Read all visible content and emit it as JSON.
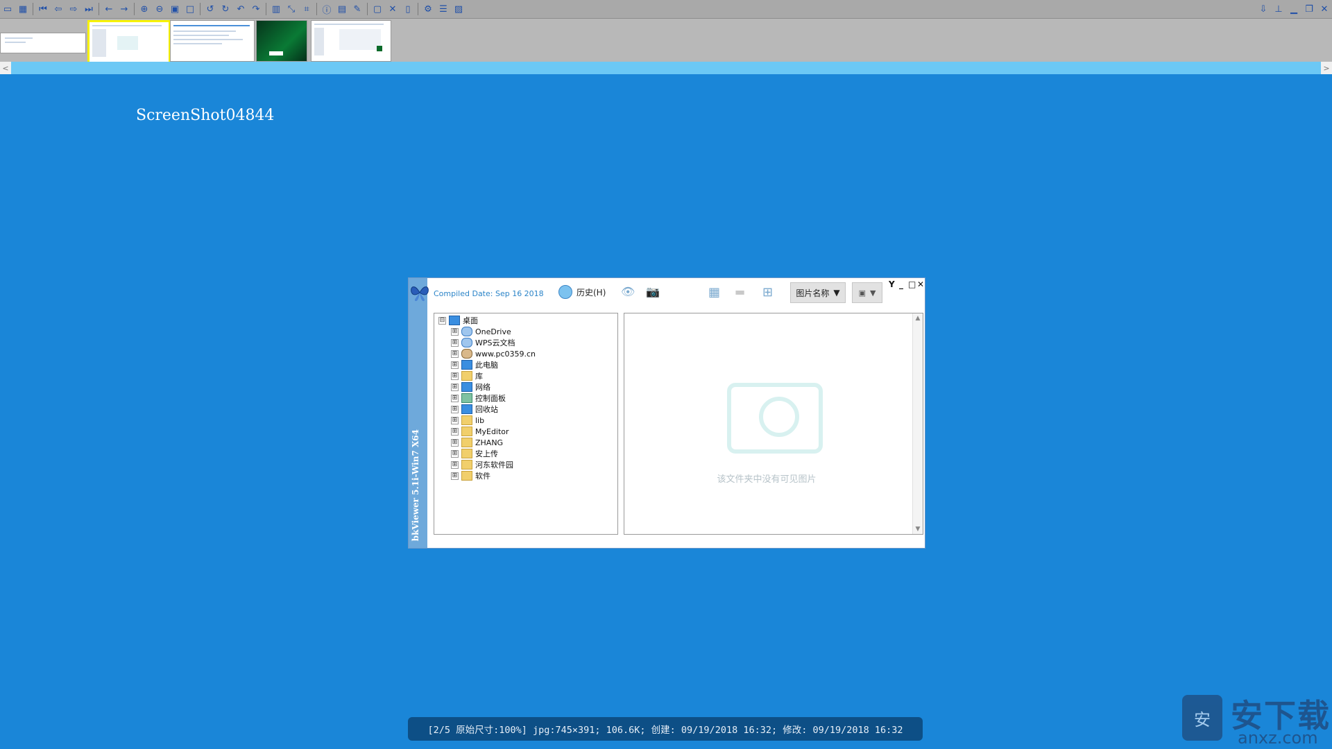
{
  "toolbar": {
    "left_icons": [
      "file-icon",
      "grid-icon",
      "first-icon",
      "prev-icon",
      "next-icon",
      "last-icon",
      "back-icon",
      "forward-icon",
      "zoom-in-icon",
      "zoom-out-icon",
      "fit-icon",
      "rect-icon",
      "rotate-left-icon",
      "rotate-right-icon",
      "undo-icon",
      "redo-icon",
      "color-icon",
      "resize-icon",
      "crop-icon",
      "info-icon",
      "histogram-icon",
      "edit-icon",
      "window-icon",
      "delete-icon",
      "copy-icon",
      "settings-icon",
      "list-icon",
      "folder-icon"
    ],
    "glyphs": [
      "▭",
      "▦",
      "⏮",
      "⇦",
      "⇨",
      "⏭",
      "←",
      "→",
      "⊕",
      "⊖",
      "▣",
      "□",
      "↺",
      "↻",
      "↶",
      "↷",
      "▥",
      "⤡",
      "⌗",
      "ⓘ",
      "▤",
      "✎",
      "▢",
      "✕",
      "▯",
      "⚙",
      "☰",
      "▨"
    ],
    "right_icons": [
      "download-icon",
      "pin-icon",
      "minimize-icon",
      "restore-icon",
      "close-icon"
    ],
    "right_glyphs": [
      "⇩",
      "⊥",
      "▁",
      "❐",
      "✕"
    ]
  },
  "thumbnails": [
    {
      "name": "thumb-1",
      "selected": false
    },
    {
      "name": "thumb-2",
      "selected": true
    },
    {
      "name": "thumb-3",
      "selected": false
    },
    {
      "name": "thumb-4",
      "selected": false
    },
    {
      "name": "thumb-5",
      "selected": false
    }
  ],
  "scroll": {
    "left": "<",
    "right": ">"
  },
  "filename": "ScreenShot04844",
  "window": {
    "sidebar_title": "bkViewer 5.1i-Win7 X64",
    "compiled": "Compiled Date: Sep 16 2018",
    "history_label": "历史(H)",
    "sort_label": "图片名称",
    "controls": [
      "Y",
      "_",
      "□",
      "✕"
    ],
    "tree": [
      {
        "label": "桌面",
        "level": 0,
        "expander": "⊟",
        "icon": "blue"
      },
      {
        "label": "OneDrive",
        "level": 1,
        "expander": "⊞",
        "icon": "cloud"
      },
      {
        "label": "WPS云文档",
        "level": 1,
        "expander": "⊞",
        "icon": "cloud"
      },
      {
        "label": "www.pc0359.cn",
        "level": 1,
        "expander": "⊞",
        "icon": "user"
      },
      {
        "label": "此电脑",
        "level": 1,
        "expander": "⊞",
        "icon": "blue"
      },
      {
        "label": "库",
        "level": 1,
        "expander": "⊞",
        "icon": "folder"
      },
      {
        "label": "网络",
        "level": 1,
        "expander": "⊞",
        "icon": "blue"
      },
      {
        "label": "控制面板",
        "level": 1,
        "expander": "⊞",
        "icon": "green"
      },
      {
        "label": "回收站",
        "level": 1,
        "expander": "⊞",
        "icon": "blue"
      },
      {
        "label": "lib",
        "level": 1,
        "expander": "⊞",
        "icon": "folder"
      },
      {
        "label": "MyEditor",
        "level": 1,
        "expander": "⊞",
        "icon": "folder"
      },
      {
        "label": "ZHANG",
        "level": 1,
        "expander": "⊞",
        "icon": "folder"
      },
      {
        "label": "安上传",
        "level": 1,
        "expander": "⊞",
        "icon": "folder"
      },
      {
        "label": "河东软件园",
        "level": 1,
        "expander": "⊞",
        "icon": "folder"
      },
      {
        "label": "软件",
        "level": 1,
        "expander": "⊞",
        "icon": "folder"
      }
    ],
    "empty_message": "该文件夹中没有可见图片"
  },
  "status": "[2/5 原始尺寸:100%] jpg:745×391; 106.6K; 创建: 09/19/2018 16:32; 修改: 09/19/2018 16:32",
  "watermark": {
    "big": "安下载",
    "small": "anxz.com",
    "shield": "安"
  }
}
